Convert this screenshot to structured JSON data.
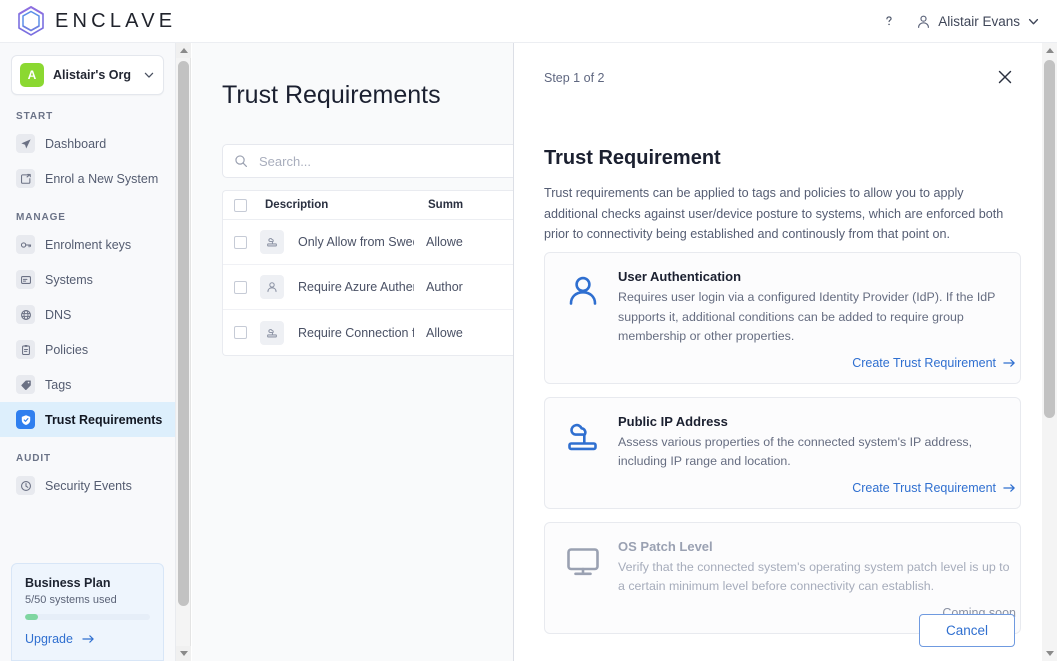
{
  "brand": {
    "name": "ENCLAVE",
    "logo_icon": "hexagon-logo-icon"
  },
  "topbar": {
    "help_icon": "help-circle-icon",
    "user_icon": "person-icon",
    "user_name": "Alistair Evans",
    "chevron_icon": "chevron-down-icon"
  },
  "sidebar": {
    "org": {
      "avatar_letter": "A",
      "name": "Alistair's Org",
      "chevron_icon": "chevron-down-icon"
    },
    "sections": [
      {
        "label": "START",
        "items": [
          {
            "label": "Dashboard",
            "icon": "paper-plane-icon",
            "active": false
          },
          {
            "label": "Enrol a New System",
            "icon": "enrol-system-icon",
            "active": false
          }
        ]
      },
      {
        "label": "MANAGE",
        "items": [
          {
            "label": "Enrolment keys",
            "icon": "key-icon",
            "active": false
          },
          {
            "label": "Systems",
            "icon": "system-icon",
            "active": false
          },
          {
            "label": "DNS",
            "icon": "globe-icon",
            "active": false
          },
          {
            "label": "Policies",
            "icon": "clipboard-icon",
            "active": false
          },
          {
            "label": "Tags",
            "icon": "tag-icon",
            "active": false
          },
          {
            "label": "Trust Requirements",
            "icon": "shield-check-icon",
            "active": true
          }
        ]
      },
      {
        "label": "AUDIT",
        "items": [
          {
            "label": "Security Events",
            "icon": "clock-icon",
            "active": false
          }
        ]
      }
    ],
    "plan": {
      "title": "Business Plan",
      "usage": "5/50 systems used",
      "progress_percent": 10,
      "upgrade_label": "Upgrade",
      "upgrade_arrow_icon": "arrow-right-icon"
    }
  },
  "main": {
    "page_title": "Trust Requirements",
    "search": {
      "placeholder": "Search...",
      "value": "",
      "icon": "search-icon"
    },
    "table": {
      "columns": [
        "Description",
        "Summ"
      ],
      "rows": [
        {
          "icon": "public-ip-icon",
          "description": "Only Allow from Sweden",
          "summary": "Allowe"
        },
        {
          "icon": "user-auth-icon",
          "description": "Require Azure Authenticati…",
          "summary": "Author"
        },
        {
          "icon": "public-ip-icon",
          "description": "Require Connection from O…",
          "summary": "Allowe"
        }
      ]
    }
  },
  "panel": {
    "step": "Step 1 of 2",
    "close_icon": "close-icon",
    "title": "Trust Requirement",
    "description": "Trust requirements can be applied to tags and policies to allow you to apply additional checks against user/device posture to systems, which are enforced both prior to connectivity being established and continously from that point on.",
    "options": [
      {
        "icon": "user-auth-icon",
        "title": "User Authentication",
        "text": "Requires user login via a configured Identity Provider (IdP). If the IdP supports it, additional conditions can be added to require group membership or other properties.",
        "action_label": "Create Trust Requirement",
        "action_arrow_icon": "arrow-right-icon",
        "disabled": false
      },
      {
        "icon": "public-ip-icon",
        "title": "Public IP Address",
        "text": "Assess various properties of the connected system's IP address, including IP range and location.",
        "action_label": "Create Trust Requirement",
        "action_arrow_icon": "arrow-right-icon",
        "disabled": false
      },
      {
        "icon": "monitor-icon",
        "title": "OS Patch Level",
        "text": "Verify that the connected system's operating system patch level is up to a certain minimum level before connectivity can establish.",
        "status_label": "Coming soon",
        "disabled": true
      }
    ],
    "cancel_label": "Cancel"
  },
  "colors": {
    "accent_blue": "#2f6fd0",
    "active_nav_bg": "#ddeffc",
    "org_avatar_green": "#8bd831",
    "progress_green": "#7fd6a1"
  }
}
